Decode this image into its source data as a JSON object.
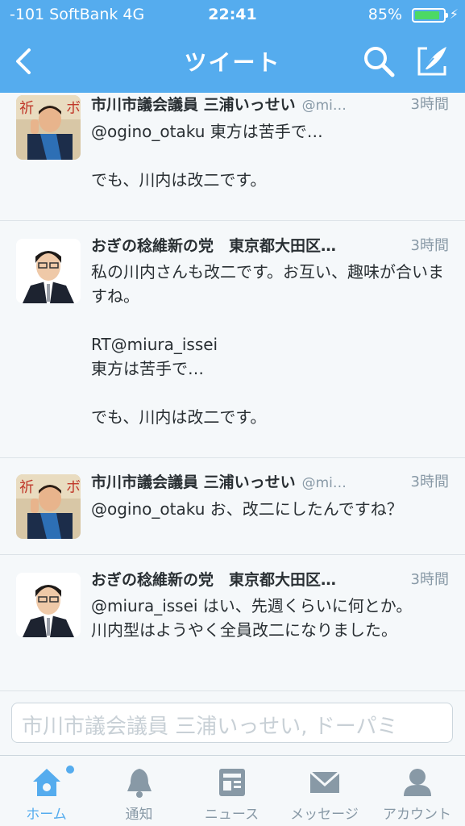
{
  "status_bar": {
    "carrier": "-101 SoftBank  4G",
    "time": "22:41",
    "battery": "85%"
  },
  "nav": {
    "title": "ツイート"
  },
  "tweets": [
    {
      "name": "市川市議会議員 三浦いっせい",
      "handle": "@mi…",
      "time": "3時間",
      "text": "@ogino_otaku 東方は苦手で…\n\nでも、川内は改二です。"
    },
    {
      "name": "おぎの稔維新の党　東京都大田区…",
      "handle": "",
      "time": "3時間",
      "text": "私の川内さんも改二です。お互い、趣味が合いますね。\n\nRT@miura_issei\n東方は苦手で…\n\nでも、川内は改二です。"
    },
    {
      "name": "市川市議会議員 三浦いっせい",
      "handle": "@mi…",
      "time": "3時間",
      "text": "@ogino_otaku お、改二にしたんですね？"
    },
    {
      "name": "おぎの稔維新の党　東京都大田区…",
      "handle": "",
      "time": "3時間",
      "text": "@miura_issei はい、先週くらいに何とか。\n川内型はようやく全員改二になりました。"
    }
  ],
  "reply": {
    "placeholder": "市川市議会議員 三浦いっせい, ドーパミ"
  },
  "tabs": [
    {
      "label": "ホーム",
      "icon": "home-icon",
      "active": true
    },
    {
      "label": "通知",
      "icon": "bell-icon",
      "active": false
    },
    {
      "label": "ニュース",
      "icon": "news-icon",
      "active": false
    },
    {
      "label": "メッセージ",
      "icon": "envelope-icon",
      "active": false
    },
    {
      "label": "アカウント",
      "icon": "person-icon",
      "active": false
    }
  ],
  "colors": {
    "accent": "#55acee",
    "background": "#f5f8fa",
    "muted": "#8899a6"
  }
}
